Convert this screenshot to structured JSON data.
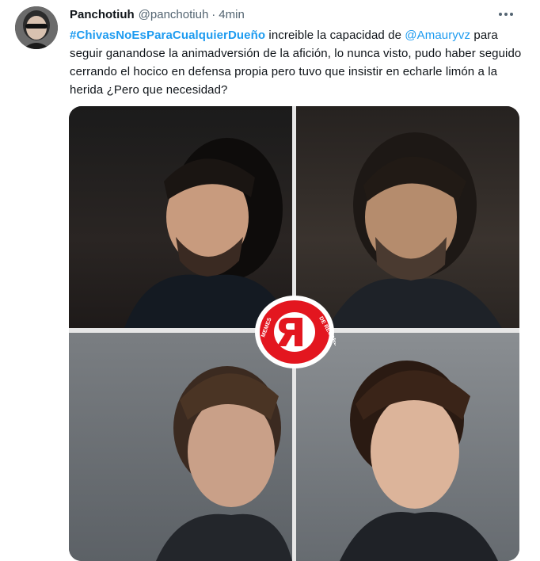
{
  "tweet": {
    "display_name": "Panchotiuh",
    "handle": "@panchotiuh",
    "separator": "·",
    "time": "4min",
    "text": {
      "hashtag": "#ChivasNoEsParaCualquierDueño",
      "part1": " increible la capacidad de ",
      "mention": "@Amauryvz",
      "part2": " para seguir ganandose la animadversión de la afición, lo nunca visto, pudo haber seguido cerrando el hocico en defensa propia pero tuvo que insistir en echarle limón a la herida ¿Pero que necesidad?"
    }
  },
  "media": {
    "logo_letter": "R",
    "logo_ring_text": "MEMES DE RÉCORD"
  },
  "colors": {
    "link": "#1d9bf0",
    "text": "#0f1419",
    "secondary": "#536471",
    "logo_red": "#e3161f"
  },
  "icons": {
    "more": "ellipsis-icon"
  }
}
